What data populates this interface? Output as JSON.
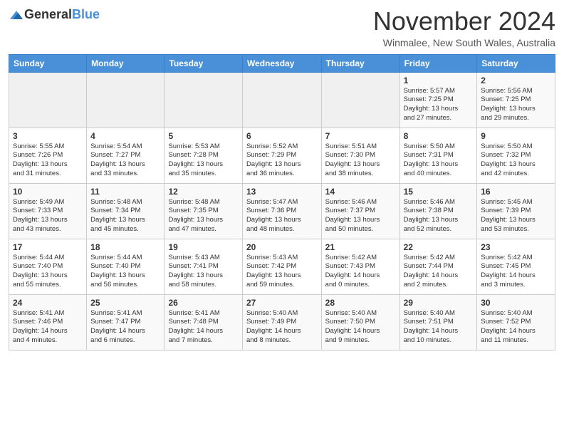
{
  "logo": {
    "general": "General",
    "blue": "Blue"
  },
  "title": "November 2024",
  "location": "Winmalee, New South Wales, Australia",
  "headers": [
    "Sunday",
    "Monday",
    "Tuesday",
    "Wednesday",
    "Thursday",
    "Friday",
    "Saturday"
  ],
  "rows": [
    [
      {
        "day": "",
        "info": ""
      },
      {
        "day": "",
        "info": ""
      },
      {
        "day": "",
        "info": ""
      },
      {
        "day": "",
        "info": ""
      },
      {
        "day": "",
        "info": ""
      },
      {
        "day": "1",
        "info": "Sunrise: 5:57 AM\nSunset: 7:25 PM\nDaylight: 13 hours\nand 27 minutes."
      },
      {
        "day": "2",
        "info": "Sunrise: 5:56 AM\nSunset: 7:25 PM\nDaylight: 13 hours\nand 29 minutes."
      }
    ],
    [
      {
        "day": "3",
        "info": "Sunrise: 5:55 AM\nSunset: 7:26 PM\nDaylight: 13 hours\nand 31 minutes."
      },
      {
        "day": "4",
        "info": "Sunrise: 5:54 AM\nSunset: 7:27 PM\nDaylight: 13 hours\nand 33 minutes."
      },
      {
        "day": "5",
        "info": "Sunrise: 5:53 AM\nSunset: 7:28 PM\nDaylight: 13 hours\nand 35 minutes."
      },
      {
        "day": "6",
        "info": "Sunrise: 5:52 AM\nSunset: 7:29 PM\nDaylight: 13 hours\nand 36 minutes."
      },
      {
        "day": "7",
        "info": "Sunrise: 5:51 AM\nSunset: 7:30 PM\nDaylight: 13 hours\nand 38 minutes."
      },
      {
        "day": "8",
        "info": "Sunrise: 5:50 AM\nSunset: 7:31 PM\nDaylight: 13 hours\nand 40 minutes."
      },
      {
        "day": "9",
        "info": "Sunrise: 5:50 AM\nSunset: 7:32 PM\nDaylight: 13 hours\nand 42 minutes."
      }
    ],
    [
      {
        "day": "10",
        "info": "Sunrise: 5:49 AM\nSunset: 7:33 PM\nDaylight: 13 hours\nand 43 minutes."
      },
      {
        "day": "11",
        "info": "Sunrise: 5:48 AM\nSunset: 7:34 PM\nDaylight: 13 hours\nand 45 minutes."
      },
      {
        "day": "12",
        "info": "Sunrise: 5:48 AM\nSunset: 7:35 PM\nDaylight: 13 hours\nand 47 minutes."
      },
      {
        "day": "13",
        "info": "Sunrise: 5:47 AM\nSunset: 7:36 PM\nDaylight: 13 hours\nand 48 minutes."
      },
      {
        "day": "14",
        "info": "Sunrise: 5:46 AM\nSunset: 7:37 PM\nDaylight: 13 hours\nand 50 minutes."
      },
      {
        "day": "15",
        "info": "Sunrise: 5:46 AM\nSunset: 7:38 PM\nDaylight: 13 hours\nand 52 minutes."
      },
      {
        "day": "16",
        "info": "Sunrise: 5:45 AM\nSunset: 7:39 PM\nDaylight: 13 hours\nand 53 minutes."
      }
    ],
    [
      {
        "day": "17",
        "info": "Sunrise: 5:44 AM\nSunset: 7:40 PM\nDaylight: 13 hours\nand 55 minutes."
      },
      {
        "day": "18",
        "info": "Sunrise: 5:44 AM\nSunset: 7:40 PM\nDaylight: 13 hours\nand 56 minutes."
      },
      {
        "day": "19",
        "info": "Sunrise: 5:43 AM\nSunset: 7:41 PM\nDaylight: 13 hours\nand 58 minutes."
      },
      {
        "day": "20",
        "info": "Sunrise: 5:43 AM\nSunset: 7:42 PM\nDaylight: 13 hours\nand 59 minutes."
      },
      {
        "day": "21",
        "info": "Sunrise: 5:42 AM\nSunset: 7:43 PM\nDaylight: 14 hours\nand 0 minutes."
      },
      {
        "day": "22",
        "info": "Sunrise: 5:42 AM\nSunset: 7:44 PM\nDaylight: 14 hours\nand 2 minutes."
      },
      {
        "day": "23",
        "info": "Sunrise: 5:42 AM\nSunset: 7:45 PM\nDaylight: 14 hours\nand 3 minutes."
      }
    ],
    [
      {
        "day": "24",
        "info": "Sunrise: 5:41 AM\nSunset: 7:46 PM\nDaylight: 14 hours\nand 4 minutes."
      },
      {
        "day": "25",
        "info": "Sunrise: 5:41 AM\nSunset: 7:47 PM\nDaylight: 14 hours\nand 6 minutes."
      },
      {
        "day": "26",
        "info": "Sunrise: 5:41 AM\nSunset: 7:48 PM\nDaylight: 14 hours\nand 7 minutes."
      },
      {
        "day": "27",
        "info": "Sunrise: 5:40 AM\nSunset: 7:49 PM\nDaylight: 14 hours\nand 8 minutes."
      },
      {
        "day": "28",
        "info": "Sunrise: 5:40 AM\nSunset: 7:50 PM\nDaylight: 14 hours\nand 9 minutes."
      },
      {
        "day": "29",
        "info": "Sunrise: 5:40 AM\nSunset: 7:51 PM\nDaylight: 14 hours\nand 10 minutes."
      },
      {
        "day": "30",
        "info": "Sunrise: 5:40 AM\nSunset: 7:52 PM\nDaylight: 14 hours\nand 11 minutes."
      }
    ]
  ]
}
